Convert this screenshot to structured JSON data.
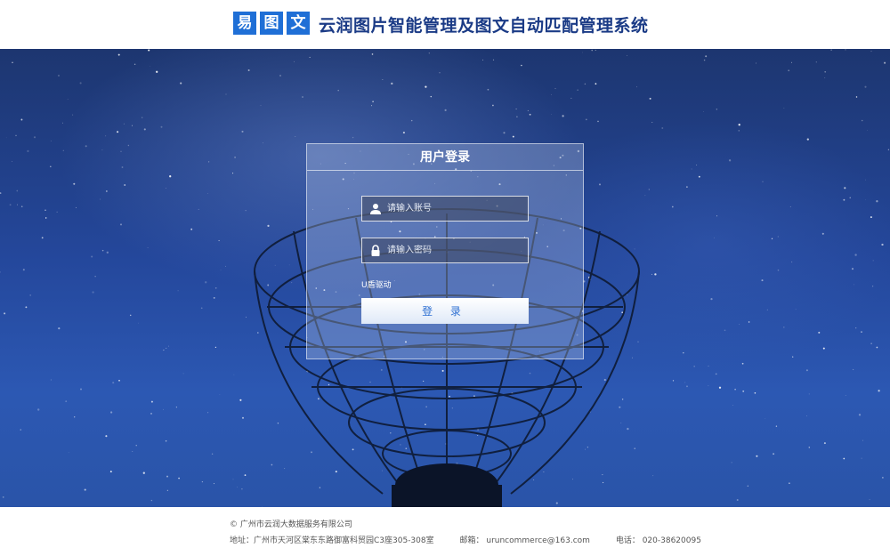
{
  "header": {
    "logo_chars": [
      "易",
      "图",
      "文"
    ],
    "system_title": "云润图片智能管理及图文自动匹配管理系统"
  },
  "login": {
    "title": "用户登录",
    "username_placeholder": "请输入账号",
    "password_placeholder": "请输入密码",
    "usb_driver_link": "U盾驱动",
    "submit_label": "登 录"
  },
  "footer": {
    "copyright": "© 广州市云润大数据服务有限公司",
    "address": "地址：广州市天河区棠东东路御富科贸园C3座305-308室",
    "email": "邮箱： uruncommerce@163.com",
    "phone": "电话： 020-38620095"
  },
  "colors": {
    "brand_blue": "#1f6fd6",
    "title_navy": "#1b3b86",
    "button_text": "#2d6fd2"
  },
  "icons": {
    "username": "user-icon",
    "password": "lock-icon"
  }
}
